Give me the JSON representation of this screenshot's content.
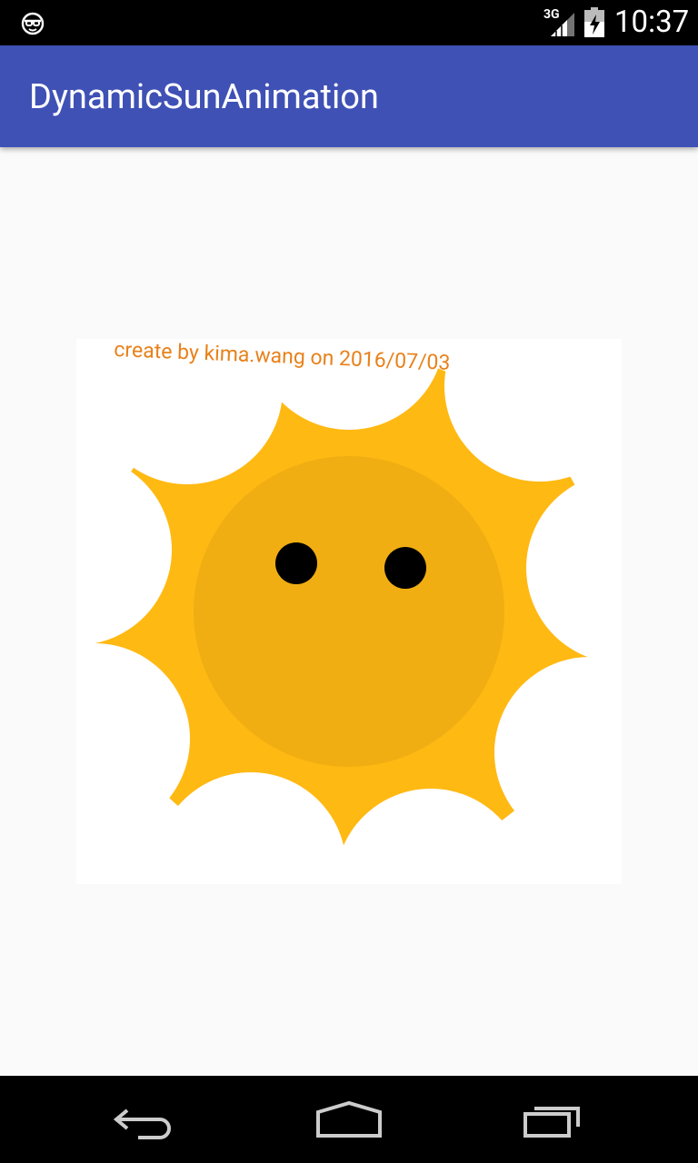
{
  "status_bar": {
    "network": "3G",
    "time": "10:37",
    "icons": [
      "notification-icon",
      "signal-icon",
      "battery-icon"
    ]
  },
  "app_bar": {
    "title": "DynamicSunAnimation"
  },
  "canvas": {
    "credit": "create by kima.wang   on 2016/07/03",
    "colors": {
      "rays": "#ffb913",
      "face": "#f0ae12",
      "eyes": "#000000",
      "credit_text": "#e8811a",
      "background": "#ffffff"
    }
  },
  "nav_bar": {
    "buttons": [
      "back-icon",
      "home-icon",
      "recents-icon"
    ]
  }
}
